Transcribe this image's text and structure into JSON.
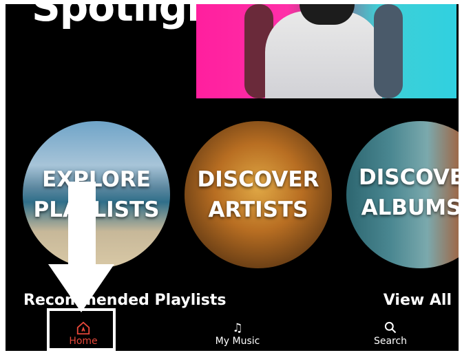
{
  "hero": {
    "title": "Spotlight"
  },
  "categories": [
    {
      "line1": "EXPLORE",
      "line2": "PLAYLISTS"
    },
    {
      "line1": "DISCOVER",
      "line2": "ARTISTS"
    },
    {
      "line1": "DISCOVE",
      "line2": "ALBUMS"
    }
  ],
  "section": {
    "title": "Recommended Playlists",
    "view_all": "View All"
  },
  "nav": {
    "home": "Home",
    "my_music": "My Music",
    "search": "Search",
    "active_color": "#e8483a"
  },
  "icons": {
    "home": "home-icon",
    "music": "music-note-icon",
    "search": "search-icon"
  }
}
